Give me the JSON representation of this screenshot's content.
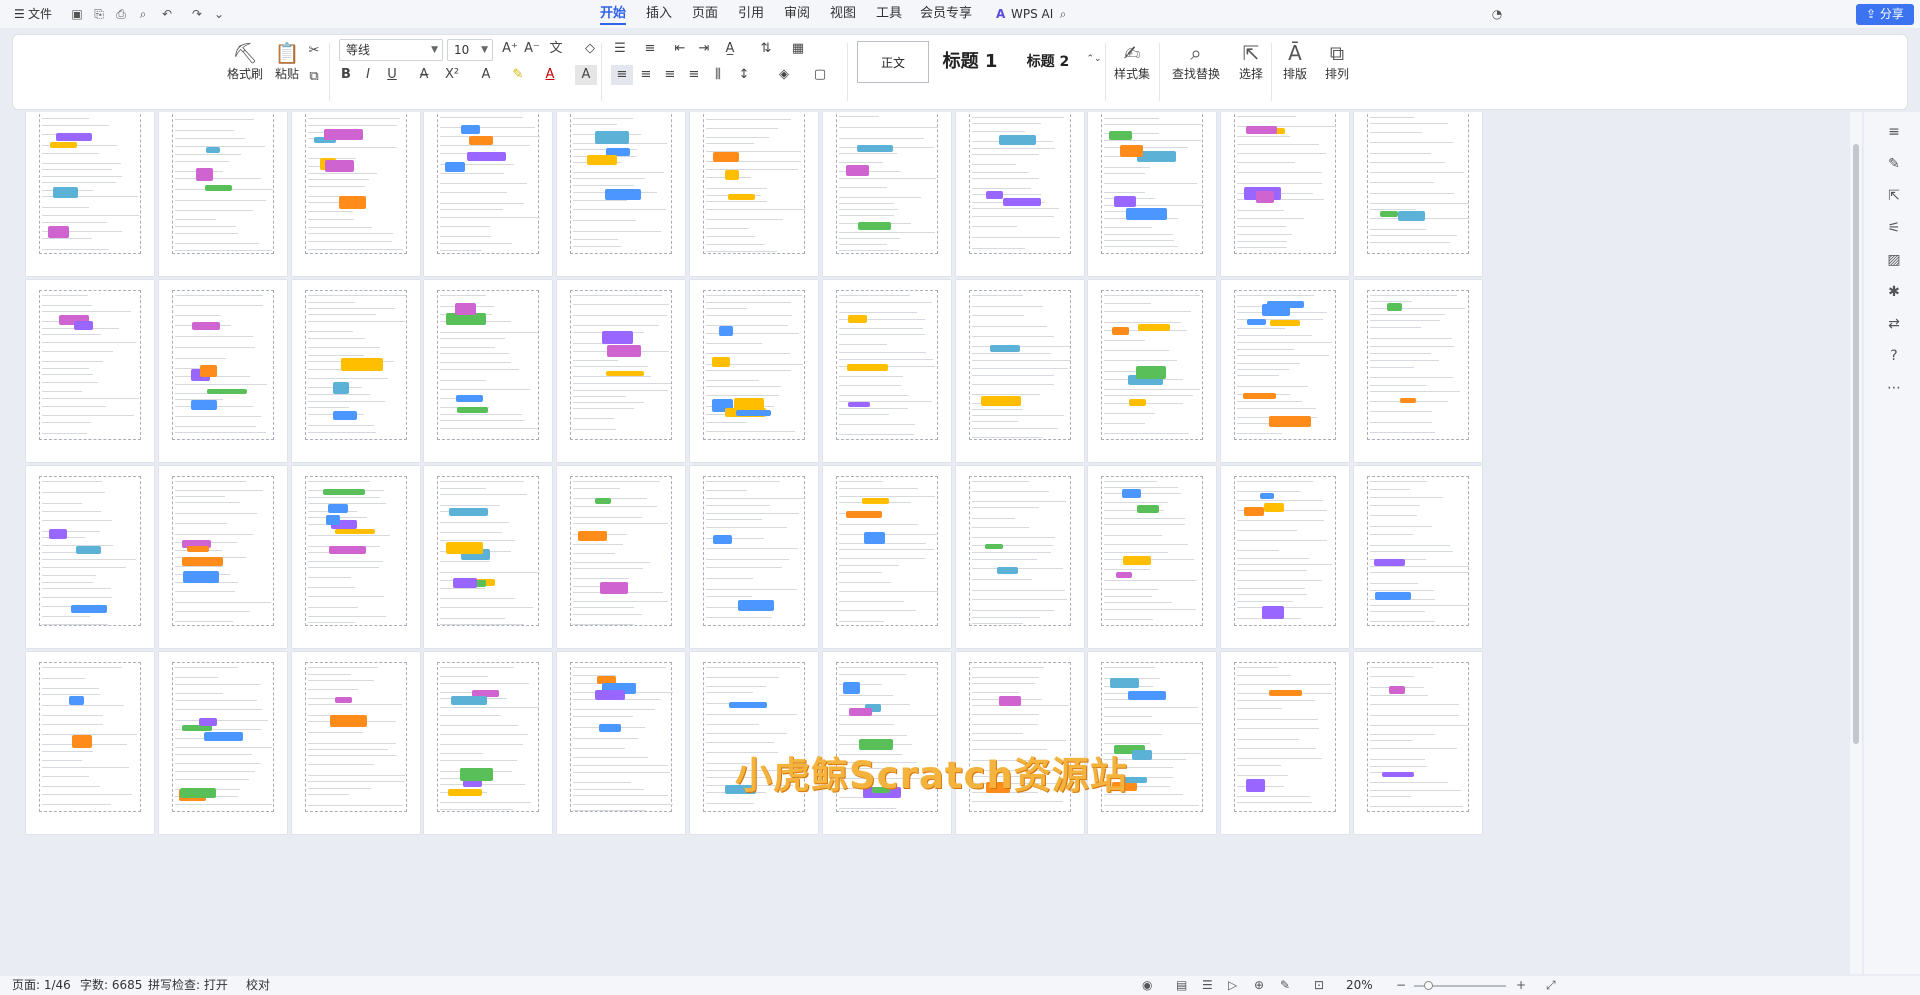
{
  "titlebar": {
    "menu_label": "文件",
    "menu_icon": "hamburger-icon",
    "tabs": [
      "开始",
      "插入",
      "页面",
      "引用",
      "审阅",
      "视图",
      "工具",
      "会员专享"
    ],
    "active_tab": "开始",
    "wps_ai": "WPS AI",
    "share": "分享"
  },
  "ribbon": {
    "format_painter": "格式刷",
    "paste": "粘贴",
    "font_name": "等线",
    "font_size": "10",
    "styles": {
      "normal": "正文",
      "h1": "标题 1",
      "h2": "标题 2"
    },
    "style_set": "样式集",
    "find_replace": "查找替换",
    "select": "选择",
    "layout": "排版",
    "arrange": "排列"
  },
  "watermark": "小虎鲸Scratch资源站",
  "statusbar": {
    "page": "页面: 1/46",
    "words": "字数: 6685",
    "spell": "拼写检查: 打开",
    "proof": "校对",
    "zoom": "20%"
  },
  "colors": {
    "accent": "#2f64e9",
    "share_bg": "#3b73f0",
    "watermark": "#f4b33d"
  }
}
